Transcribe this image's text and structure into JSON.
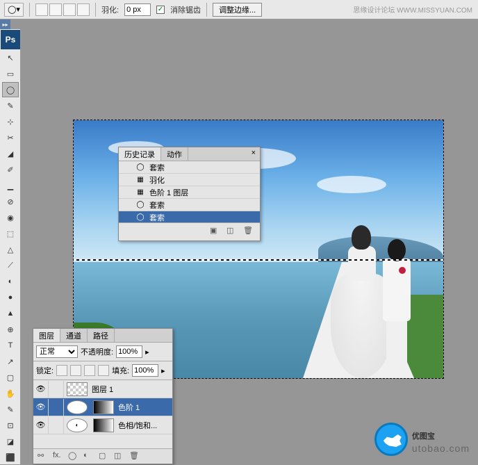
{
  "topbar": {
    "feather_label": "羽化:",
    "feather_value": "0 px",
    "antialias_label": "消除锯齿",
    "refine_edge_label": "调整边缘..."
  },
  "watermark_top": "思缘设计论坛 WWW.MISSYUAN.COM",
  "history_panel": {
    "tab_history": "历史记录",
    "tab_actions": "动作",
    "close": "×",
    "items": [
      {
        "icon": "◯",
        "label": "套索"
      },
      {
        "icon": "▦",
        "label": "羽化"
      },
      {
        "icon": "▦",
        "label": "色阶 1 图层"
      },
      {
        "icon": "◯",
        "label": "套索"
      },
      {
        "icon": "◯",
        "label": "套索",
        "selected": true
      }
    ]
  },
  "layers_panel": {
    "tab_layers": "图层",
    "tab_channels": "通道",
    "tab_paths": "路径",
    "blend_mode": "正常",
    "opacity_label": "不透明度:",
    "opacity_value": "100%",
    "lock_label": "锁定:",
    "fill_label": "填充:",
    "fill_value": "100%",
    "layers": [
      {
        "name": "图层 1",
        "thumb": "check"
      },
      {
        "name": "色阶 1",
        "thumb": "adj",
        "mask": true,
        "selected": true
      },
      {
        "name": "色相/饱和...",
        "thumb": "adj",
        "mask": true
      }
    ]
  },
  "watermark_bottom": {
    "text_main": "优图宝",
    "url": "utobao.com"
  },
  "tools": [
    "↖",
    "▭",
    "◯",
    "✎",
    "⊹",
    "✂",
    "◢",
    "✐",
    "▁",
    "⊘",
    "◉",
    "⬚",
    "△",
    "⟋",
    "◐",
    "●",
    "▲",
    "⊕",
    "T",
    "↗",
    "▢",
    "✋",
    "✎",
    "⊡",
    "◪",
    "⬛"
  ]
}
